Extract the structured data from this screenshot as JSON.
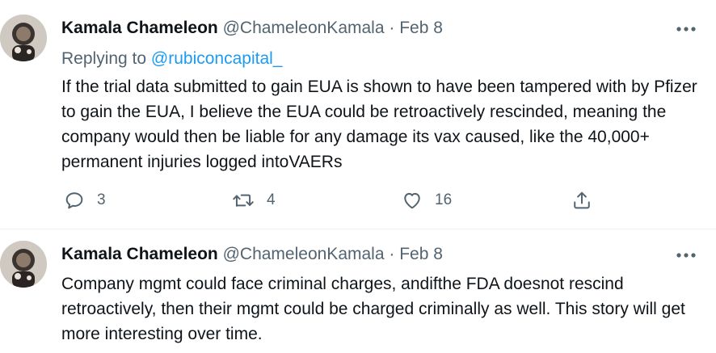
{
  "tweets": [
    {
      "author_name": "Kamala Chameleon",
      "author_handle": "@ChameleonKamala",
      "separator": "·",
      "date": "Feb 8",
      "replying_prefix": "Replying to",
      "replying_mention": "@rubiconcapital_",
      "text": "If the trial data submitted to gain EUA is shown to have been tampered with by Pfizer to gain the EUA, I believe the EUA could be retroactively rescinded, meaning the company would then be liable for any damage its vax caused, like the 40,000+ permanent injuries logged intoVAERs",
      "stats": {
        "replies": "3",
        "retweets": "4",
        "likes": "16"
      }
    },
    {
      "author_name": "Kamala Chameleon",
      "author_handle": "@ChameleonKamala",
      "separator": "·",
      "date": "Feb 8",
      "text": "Company mgmt could face criminal charges, andifthe FDA doesnot rescind retroactively, then their mgmt could be charged criminally as well. This story will get more interesting over time."
    }
  ],
  "icons": {
    "avatar": "avatar-photo",
    "more": "more-horizontal-icon",
    "reply": "reply-icon",
    "retweet": "retweet-icon",
    "like": "heart-icon",
    "share": "share-icon"
  },
  "colors": {
    "text": "#0f1419",
    "secondary": "#536471",
    "link": "#1d9bf0",
    "divider": "#eff3f4"
  }
}
